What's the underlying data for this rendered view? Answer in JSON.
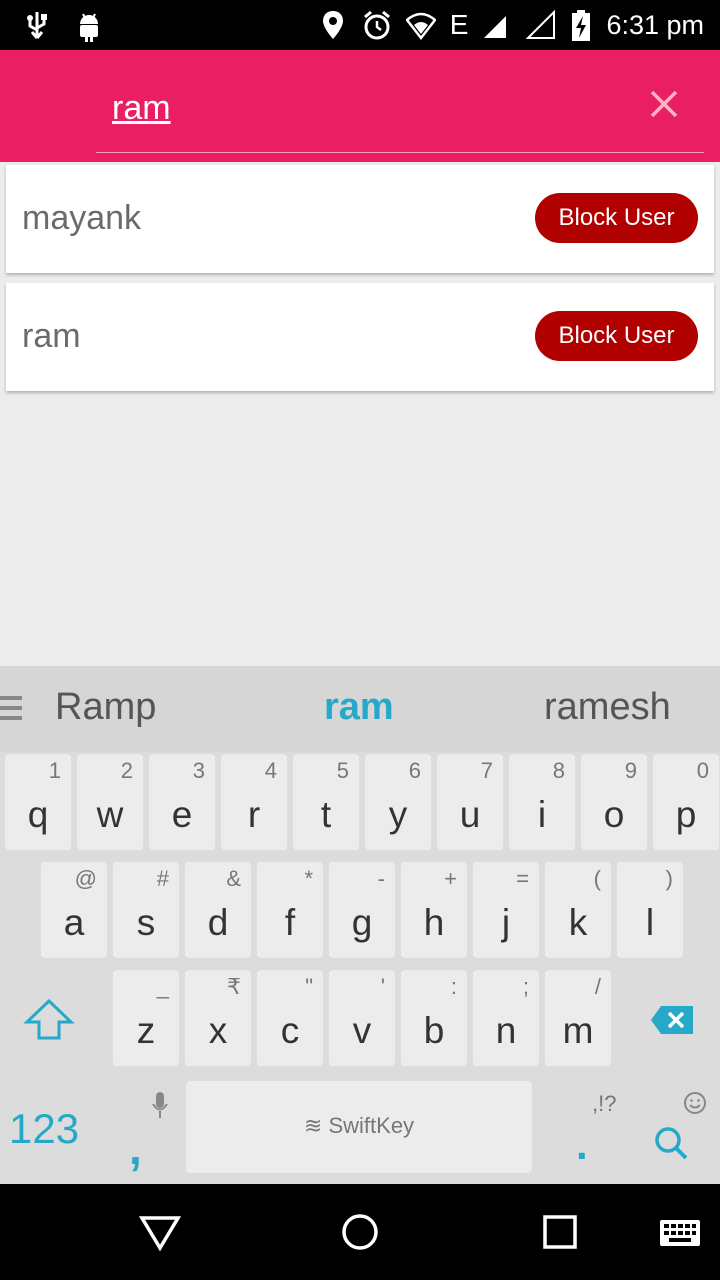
{
  "status_bar": {
    "time": "6:31 pm",
    "network": "E",
    "icons": [
      "usb-icon",
      "android-icon",
      "location-icon",
      "alarm-icon",
      "wifi-icon",
      "signal-icon",
      "signal-empty-icon",
      "battery-charging-icon"
    ]
  },
  "search": {
    "query": "ram",
    "clear_icon": "close-icon"
  },
  "results": [
    {
      "name": "mayank",
      "action": "Block User"
    },
    {
      "name": "ram",
      "action": "Block User"
    }
  ],
  "keyboard": {
    "suggestions": [
      "Ramp",
      "ram",
      "ramesh"
    ],
    "row1": [
      {
        "key": "q",
        "hint": "1"
      },
      {
        "key": "w",
        "hint": "2"
      },
      {
        "key": "e",
        "hint": "3"
      },
      {
        "key": "r",
        "hint": "4"
      },
      {
        "key": "t",
        "hint": "5"
      },
      {
        "key": "y",
        "hint": "6"
      },
      {
        "key": "u",
        "hint": "7"
      },
      {
        "key": "i",
        "hint": "8"
      },
      {
        "key": "o",
        "hint": "9"
      },
      {
        "key": "p",
        "hint": "0"
      }
    ],
    "row2": [
      {
        "key": "a",
        "hint": "@"
      },
      {
        "key": "s",
        "hint": "#"
      },
      {
        "key": "d",
        "hint": "&"
      },
      {
        "key": "f",
        "hint": "*"
      },
      {
        "key": "g",
        "hint": "-"
      },
      {
        "key": "h",
        "hint": "+"
      },
      {
        "key": "j",
        "hint": "="
      },
      {
        "key": "k",
        "hint": "("
      },
      {
        "key": "l",
        "hint": ")"
      }
    ],
    "row3": [
      {
        "key": "z",
        "hint": "_"
      },
      {
        "key": "x",
        "hint": "₹"
      },
      {
        "key": "c",
        "hint": "\""
      },
      {
        "key": "v",
        "hint": "'"
      },
      {
        "key": "b",
        "hint": ":"
      },
      {
        "key": "n",
        "hint": ";"
      },
      {
        "key": "m",
        "hint": "/"
      }
    ],
    "numbers_key": "123",
    "comma_key": ",",
    "period_key": ".",
    "period_hint": ",!?",
    "space_brand": "SwiftKey",
    "accent_color": "#26a9c8"
  },
  "colors": {
    "header": "#e91e63",
    "block_button": "#b00000"
  }
}
